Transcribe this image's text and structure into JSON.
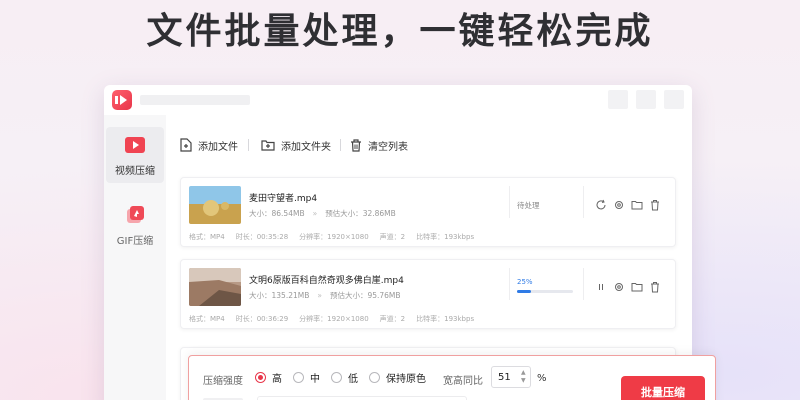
{
  "headline": "文件批量处理，一键轻松完成",
  "colors": {
    "accent": "#ef3b46",
    "progress": "#2f7be6"
  },
  "sidebar": {
    "items": [
      {
        "label": "视频压缩",
        "icon": "video-compress-icon",
        "active": true
      },
      {
        "label": "GIF压缩",
        "icon": "gif-compress-icon",
        "active": false
      }
    ]
  },
  "toolbar": {
    "add_file": "添加文件",
    "add_folder": "添加文件夹",
    "clear_list": "清空列表"
  },
  "files": [
    {
      "name": "麦田守望者.mp4",
      "size_label": "大小：",
      "size": "86.54MB",
      "est_label": "预估大小：",
      "est_size": "32.86MB",
      "status": "待处理",
      "meta": {
        "format": "格式：MP4",
        "duration": "时长：00:35:28",
        "resolution": "分辨率：1920×1080",
        "channels": "声道：2",
        "bitrate": "比特率：193kbps"
      }
    },
    {
      "name": "文明6原版百科自然奇观多佛白崖.mp4",
      "size_label": "大小：",
      "size": "135.21MB",
      "est_label": "预估大小：",
      "est_size": "95.76MB",
      "progress_label": "25%",
      "progress": 0.25,
      "meta": {
        "format": "格式：MP4",
        "duration": "时长：00:36:29",
        "resolution": "分辨率：1920×1080",
        "channels": "声道：2",
        "bitrate": "比特率：193kbps"
      }
    }
  ],
  "settings": {
    "strength_label": "压缩强度",
    "options": [
      "高",
      "中",
      "低",
      "保持原色"
    ],
    "selected": "高",
    "ratio_label": "宽高同比",
    "ratio_value": "51",
    "ratio_unit": "%",
    "batch_button": "批量压缩"
  }
}
